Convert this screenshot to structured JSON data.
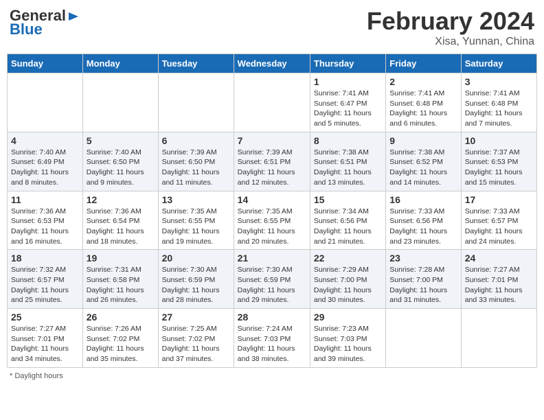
{
  "logo": {
    "line1": "General",
    "line2": "Blue"
  },
  "title": "February 2024",
  "subtitle": "Xisa, Yunnan, China",
  "weekdays": [
    "Sunday",
    "Monday",
    "Tuesday",
    "Wednesday",
    "Thursday",
    "Friday",
    "Saturday"
  ],
  "weeks": [
    [
      {
        "day": "",
        "info": ""
      },
      {
        "day": "",
        "info": ""
      },
      {
        "day": "",
        "info": ""
      },
      {
        "day": "",
        "info": ""
      },
      {
        "day": "1",
        "info": "Sunrise: 7:41 AM\nSunset: 6:47 PM\nDaylight: 11 hours and 5 minutes."
      },
      {
        "day": "2",
        "info": "Sunrise: 7:41 AM\nSunset: 6:48 PM\nDaylight: 11 hours and 6 minutes."
      },
      {
        "day": "3",
        "info": "Sunrise: 7:41 AM\nSunset: 6:48 PM\nDaylight: 11 hours and 7 minutes."
      }
    ],
    [
      {
        "day": "4",
        "info": "Sunrise: 7:40 AM\nSunset: 6:49 PM\nDaylight: 11 hours and 8 minutes."
      },
      {
        "day": "5",
        "info": "Sunrise: 7:40 AM\nSunset: 6:50 PM\nDaylight: 11 hours and 9 minutes."
      },
      {
        "day": "6",
        "info": "Sunrise: 7:39 AM\nSunset: 6:50 PM\nDaylight: 11 hours and 11 minutes."
      },
      {
        "day": "7",
        "info": "Sunrise: 7:39 AM\nSunset: 6:51 PM\nDaylight: 11 hours and 12 minutes."
      },
      {
        "day": "8",
        "info": "Sunrise: 7:38 AM\nSunset: 6:51 PM\nDaylight: 11 hours and 13 minutes."
      },
      {
        "day": "9",
        "info": "Sunrise: 7:38 AM\nSunset: 6:52 PM\nDaylight: 11 hours and 14 minutes."
      },
      {
        "day": "10",
        "info": "Sunrise: 7:37 AM\nSunset: 6:53 PM\nDaylight: 11 hours and 15 minutes."
      }
    ],
    [
      {
        "day": "11",
        "info": "Sunrise: 7:36 AM\nSunset: 6:53 PM\nDaylight: 11 hours and 16 minutes."
      },
      {
        "day": "12",
        "info": "Sunrise: 7:36 AM\nSunset: 6:54 PM\nDaylight: 11 hours and 18 minutes."
      },
      {
        "day": "13",
        "info": "Sunrise: 7:35 AM\nSunset: 6:55 PM\nDaylight: 11 hours and 19 minutes."
      },
      {
        "day": "14",
        "info": "Sunrise: 7:35 AM\nSunset: 6:55 PM\nDaylight: 11 hours and 20 minutes."
      },
      {
        "day": "15",
        "info": "Sunrise: 7:34 AM\nSunset: 6:56 PM\nDaylight: 11 hours and 21 minutes."
      },
      {
        "day": "16",
        "info": "Sunrise: 7:33 AM\nSunset: 6:56 PM\nDaylight: 11 hours and 23 minutes."
      },
      {
        "day": "17",
        "info": "Sunrise: 7:33 AM\nSunset: 6:57 PM\nDaylight: 11 hours and 24 minutes."
      }
    ],
    [
      {
        "day": "18",
        "info": "Sunrise: 7:32 AM\nSunset: 6:57 PM\nDaylight: 11 hours and 25 minutes."
      },
      {
        "day": "19",
        "info": "Sunrise: 7:31 AM\nSunset: 6:58 PM\nDaylight: 11 hours and 26 minutes."
      },
      {
        "day": "20",
        "info": "Sunrise: 7:30 AM\nSunset: 6:59 PM\nDaylight: 11 hours and 28 minutes."
      },
      {
        "day": "21",
        "info": "Sunrise: 7:30 AM\nSunset: 6:59 PM\nDaylight: 11 hours and 29 minutes."
      },
      {
        "day": "22",
        "info": "Sunrise: 7:29 AM\nSunset: 7:00 PM\nDaylight: 11 hours and 30 minutes."
      },
      {
        "day": "23",
        "info": "Sunrise: 7:28 AM\nSunset: 7:00 PM\nDaylight: 11 hours and 31 minutes."
      },
      {
        "day": "24",
        "info": "Sunrise: 7:27 AM\nSunset: 7:01 PM\nDaylight: 11 hours and 33 minutes."
      }
    ],
    [
      {
        "day": "25",
        "info": "Sunrise: 7:27 AM\nSunset: 7:01 PM\nDaylight: 11 hours and 34 minutes."
      },
      {
        "day": "26",
        "info": "Sunrise: 7:26 AM\nSunset: 7:02 PM\nDaylight: 11 hours and 35 minutes."
      },
      {
        "day": "27",
        "info": "Sunrise: 7:25 AM\nSunset: 7:02 PM\nDaylight: 11 hours and 37 minutes."
      },
      {
        "day": "28",
        "info": "Sunrise: 7:24 AM\nSunset: 7:03 PM\nDaylight: 11 hours and 38 minutes."
      },
      {
        "day": "29",
        "info": "Sunrise: 7:23 AM\nSunset: 7:03 PM\nDaylight: 11 hours and 39 minutes."
      },
      {
        "day": "",
        "info": ""
      },
      {
        "day": "",
        "info": ""
      }
    ]
  ],
  "footer": "Daylight hours"
}
